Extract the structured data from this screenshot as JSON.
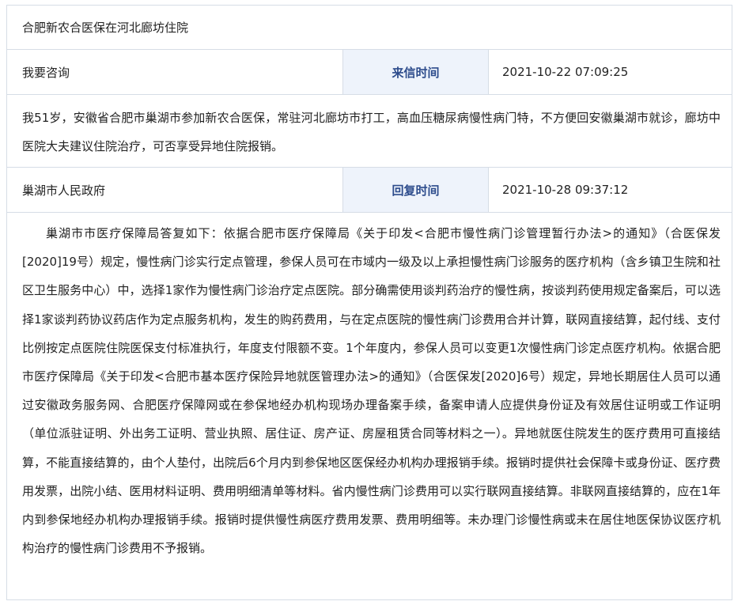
{
  "letter": {
    "title": "合肥新农合医保在河北廊坊住院",
    "inquiry": {
      "left_label": "我要咨询",
      "time_label": "来信时间",
      "time_value": "2021-10-22 07:09:25",
      "content": "我51岁，安徽省合肥市巢湖市参加新农合医保，常驻河北廊坊市打工，高血压糖尿病慢性病门特，不方便回安徽巢湖市就诊，廊坊中医院大夫建议住院治疗，可否享受异地住院报销。"
    },
    "reply": {
      "department": "巢湖市人民政府",
      "time_label": "回复时间",
      "time_value": "2021-10-28 09:37:12",
      "content": "巢湖市市医疗保障局答复如下：依据合肥市医疗保障局《关于印发<合肥市慢性病门诊管理暂行办法>的通知》（合医保发[2020]19号）规定，慢性病门诊实行定点管理，参保人员可在市域内一级及以上承担慢性病门诊服务的医疗机构（含乡镇卫生院和社区卫生服务中心）中，选择1家作为慢性病门诊治疗定点医院。部分确需使用谈判药治疗的慢性病，按谈判药使用规定备案后，可以选择1家谈判药协议药店作为定点服务机构，发生的购药费用，与在定点医院的慢性病门诊费用合并计算，联网直接结算，起付线、支付比例按定点医院住院医保支付标准执行，年度支付限额不变。1个年度内，参保人员可以变更1次慢性病门诊定点医疗机构。依据合肥市医疗保障局《关于印发<合肥市基本医疗保险异地就医管理办法>的通知》（合医保发[2020]6号）规定，异地长期居住人员可以通过安徽政务服务网、合肥医疗保障网或在参保地经办机构现场办理备案手续，备案申请人应提供身份证及有效居住证明或工作证明（单位派驻证明、外出务工证明、营业执照、居住证、房产证、房屋租赁合同等材料之一）。异地就医住院发生的医疗费用可直接结算，不能直接结算的，由个人垫付，出院后6个月内到参保地区医保经办机构办理报销手续。报销时提供社会保障卡或身份证、医疗费用发票，出院小结、医用材料证明、费用明细清单等材料。省内慢性病门诊费用可以实行联网直接结算。非联网直接结算的，应在1年内到参保地经办机构办理报销手续。报销时提供慢性病医疗费用发票、费用明细等。未办理门诊慢性病或未在居住地医保协议医疗机构治疗的慢性病门诊费用不予报销。"
    }
  }
}
